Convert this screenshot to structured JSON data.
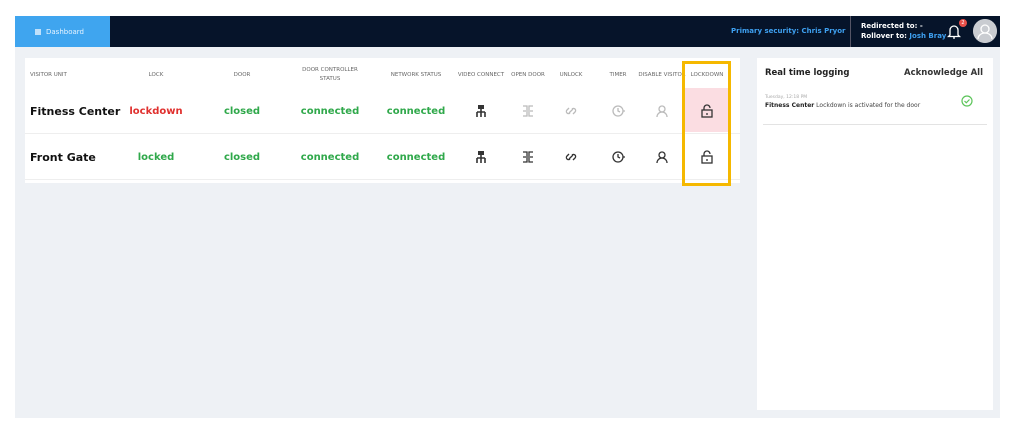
{
  "topbar": {
    "tab_label": "Dashboard",
    "primary_security": "Primary security: Chris Pryor",
    "redirected_label": "Redirected to:",
    "redirected_value": "-",
    "rollover_label": "Rollover to:",
    "rollover_value": "Josh Bray",
    "notification_count": "2"
  },
  "table": {
    "headers": [
      "VISITOR UNIT",
      "LOCK",
      "DOOR",
      "DOOR CONTROLLER STATUS",
      "NETWORK STATUS",
      "VIDEO CONNECT",
      "OPEN DOOR",
      "UNLOCK",
      "TIMER",
      "DISABLE VISITOR",
      "LOCKDOWN"
    ],
    "rows": [
      {
        "unit": "Fitness Center",
        "lock": "lockdown",
        "door": "closed",
        "controller": "connected",
        "network": "connected",
        "actions_enabled": false,
        "lockdown_active": true
      },
      {
        "unit": "Front Gate",
        "lock": "locked",
        "door": "closed",
        "controller": "connected",
        "network": "connected",
        "actions_enabled": true,
        "lockdown_active": false
      }
    ]
  },
  "logging": {
    "title": "Real time logging",
    "acknowledge_all": "Acknowledge All",
    "entries": [
      {
        "time": "Tuesday, 12:18 PM",
        "subject": "Fitness Center",
        "message": "Lockdown is activated for the door"
      }
    ]
  },
  "colors": {
    "accent": "#3fa5ef",
    "danger": "#e0302e",
    "success": "#2fa84a",
    "highlight": "#f5b800"
  }
}
